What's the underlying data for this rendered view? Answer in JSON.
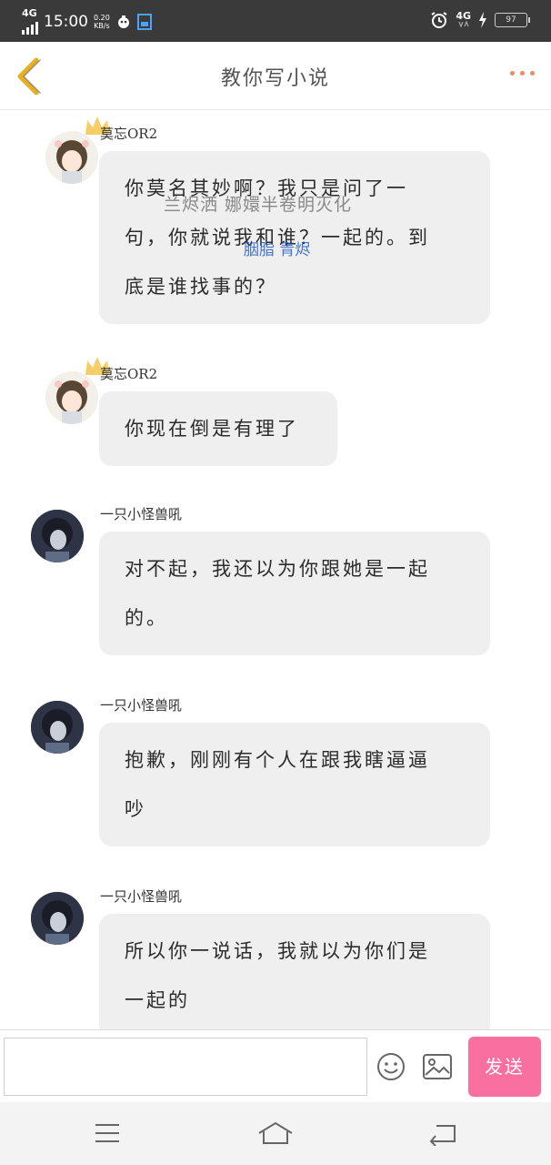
{
  "status_bar": {
    "network_left": "4G",
    "time": "15:00",
    "speed_value": "0.20",
    "speed_unit": "KB/s",
    "network_right": "4G",
    "battery": "97"
  },
  "header": {
    "title": "教你写小说"
  },
  "watermark": {
    "line1": "兰烬洒 娜嬛半卷明灭化",
    "line2": "胭脂 青烬",
    "color": "#1a56c4"
  },
  "messages": [
    {
      "sender": "莫忘OR2",
      "avatar": "avatar-girl",
      "crown": true,
      "lines": [
        "你莫名其妙啊？我只是问了一",
        "句，你就说我和谁？一起的。到",
        "底是谁找事的？"
      ]
    },
    {
      "sender": "莫忘OR2",
      "avatar": "avatar-girl",
      "crown": true,
      "lines": [
        "你现在倒是有理了"
      ]
    },
    {
      "sender": "一只小怪兽吼",
      "avatar": "avatar-boy",
      "crown": false,
      "lines": [
        "对不起，我还以为你跟她是一起",
        "的。"
      ]
    },
    {
      "sender": "一只小怪兽吼",
      "avatar": "avatar-boy",
      "crown": false,
      "lines": [
        "抱歉，刚刚有个人在跟我瞎逼逼",
        "吵"
      ]
    },
    {
      "sender": "一只小怪兽吼",
      "avatar": "avatar-boy",
      "crown": false,
      "lines": [
        "所以你一说话，我就以为你们是",
        "一起的"
      ]
    }
  ],
  "input": {
    "value": "",
    "send_label": "发送"
  },
  "colors": {
    "back_arrow": "#e8b020",
    "more_dots": "#ee8866",
    "send_button": "#f96fa0",
    "bubble": "#efefef"
  }
}
